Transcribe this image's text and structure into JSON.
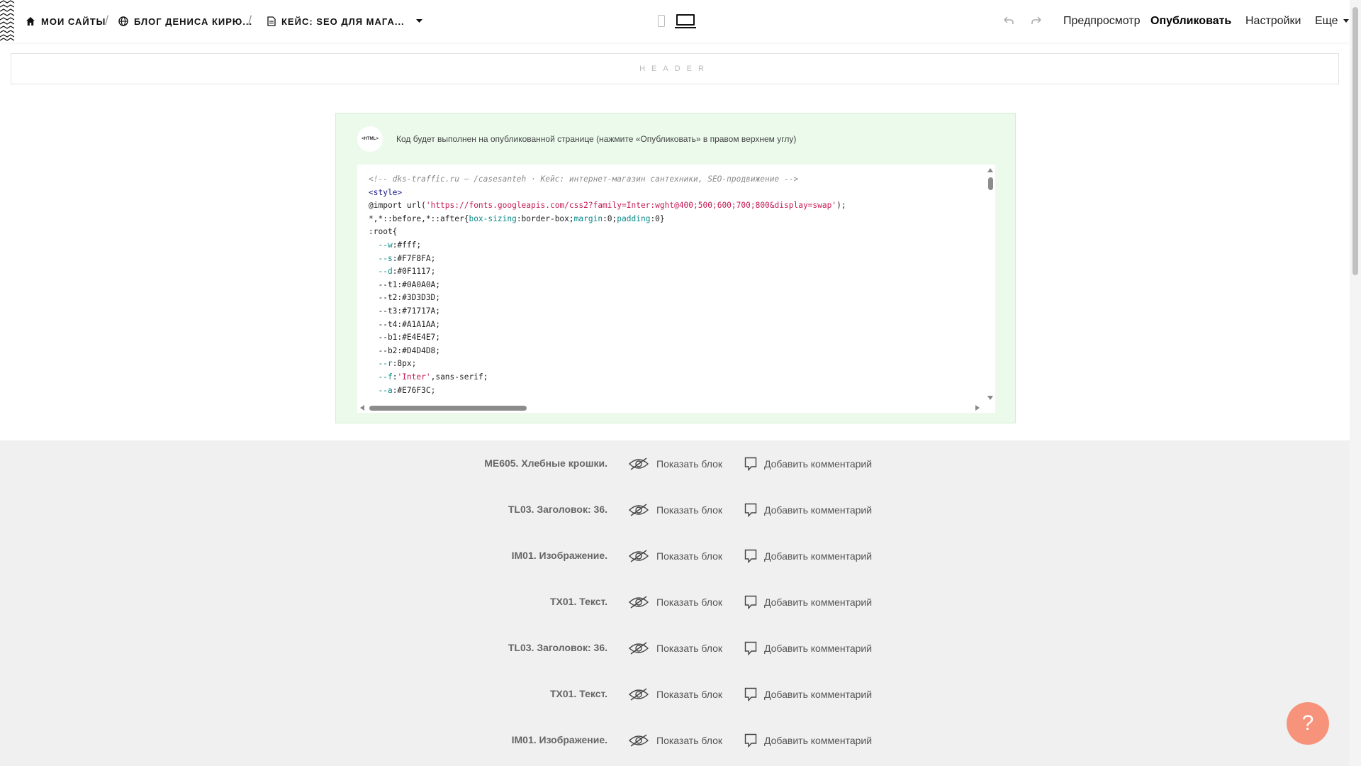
{
  "topbar": {
    "breadcrumbs": [
      {
        "label": "МОИ САЙТЫ",
        "icon": "home-icon"
      },
      {
        "label": "БЛОГ ДЕНИСА КИРЮ...",
        "icon": "globe-icon"
      },
      {
        "label": "КЕЙС: SEO ДЛЯ МАГА...",
        "icon": "document-icon"
      }
    ],
    "separator": "/",
    "menu": {
      "preview": "Предпросмотр",
      "publish": "Опубликовать",
      "settings": "Настройки",
      "more": "Еще"
    }
  },
  "header_block": {
    "label": "HEADER"
  },
  "html_block": {
    "badge": "<HTML>",
    "notice": "Код будет выполнен на опубликованной странице (нажмите «Опубликовать» в правом верхнем углу)",
    "code_lines": [
      {
        "parts": [
          {
            "t": "<!-- dks-traffic.ru — /casesanteh · Кейс: интернет-магазин сантехники, SEO-продвижение -->",
            "c": "#8a8a8a",
            "i": true
          }
        ]
      },
      {
        "parts": [
          {
            "t": "<style>",
            "c": "#1a1a8c"
          }
        ]
      },
      {
        "parts": [
          {
            "t": "@import ",
            "c": "#222"
          },
          {
            "t": "url(",
            "c": "#222"
          },
          {
            "t": "'https://fonts.googleapis.com/css2?family=Inter:wght@400;500;600;700;800&display=swap'",
            "c": "#c41a56"
          },
          {
            "t": ");",
            "c": "#222"
          }
        ]
      },
      {
        "parts": [
          {
            "t": "*,*::before,*::after{",
            "c": "#222"
          },
          {
            "t": "box-sizing",
            "c": "#0a8a8a"
          },
          {
            "t": ":border-box;",
            "c": "#222"
          },
          {
            "t": "margin",
            "c": "#0a8a8a"
          },
          {
            "t": ":0;",
            "c": "#222"
          },
          {
            "t": "padding",
            "c": "#0a8a8a"
          },
          {
            "t": ":0}",
            "c": "#222"
          }
        ]
      },
      {
        "parts": [
          {
            "t": ":root{",
            "c": "#222"
          }
        ]
      },
      {
        "parts": [
          {
            "t": "  --w",
            "c": "#0a8a8a"
          },
          {
            "t": ":#fff;",
            "c": "#222"
          }
        ]
      },
      {
        "parts": [
          {
            "t": "  --s",
            "c": "#0a8a8a"
          },
          {
            "t": ":#F7F8FA;",
            "c": "#222"
          }
        ]
      },
      {
        "parts": [
          {
            "t": "  --d",
            "c": "#0a8a8a"
          },
          {
            "t": ":#0F1117;",
            "c": "#222"
          }
        ]
      },
      {
        "parts": [
          {
            "t": "  --t1:#0A0A0A;",
            "c": "#222"
          }
        ]
      },
      {
        "parts": [
          {
            "t": "  --t2:#3D3D3D;",
            "c": "#222"
          }
        ]
      },
      {
        "parts": [
          {
            "t": "  --t3:#71717A;",
            "c": "#222"
          }
        ]
      },
      {
        "parts": [
          {
            "t": "  --t4:#A1A1AA;",
            "c": "#222"
          }
        ]
      },
      {
        "parts": [
          {
            "t": "  --b1:#E4E4E7;",
            "c": "#222"
          }
        ]
      },
      {
        "parts": [
          {
            "t": "  --b2:#D4D4D8;",
            "c": "#222"
          }
        ]
      },
      {
        "parts": [
          {
            "t": "  --r",
            "c": "#0a8a8a"
          },
          {
            "t": ":8px;",
            "c": "#222"
          }
        ]
      },
      {
        "parts": [
          {
            "t": "  --f",
            "c": "#0a8a8a"
          },
          {
            "t": ":",
            "c": "#222"
          },
          {
            "t": "'Inter'",
            "c": "#c41a56"
          },
          {
            "t": ",sans-serif;",
            "c": "#222"
          }
        ]
      },
      {
        "parts": [
          {
            "t": "  --a",
            "c": "#0a8a8a"
          },
          {
            "t": ":#E76F3C;",
            "c": "#222"
          }
        ]
      }
    ]
  },
  "hidden_blocks": {
    "show_label": "Показать блок",
    "comment_label": "Добавить комментарий",
    "items": [
      {
        "title": "ME605. Хлебные крошки."
      },
      {
        "title": "TL03. Заголовок: 36."
      },
      {
        "title": "IM01. Изображение."
      },
      {
        "title": "TX01. Текст."
      },
      {
        "title": "TL03. Заголовок: 36."
      },
      {
        "title": "TX01. Текст."
      },
      {
        "title": "IM01. Изображение."
      }
    ]
  },
  "help": {
    "label": "?"
  },
  "colors": {
    "accent_help": "#f7937b",
    "html_panel_bg": "#ebfaeb",
    "hidden_bg": "#f0f0f0"
  }
}
